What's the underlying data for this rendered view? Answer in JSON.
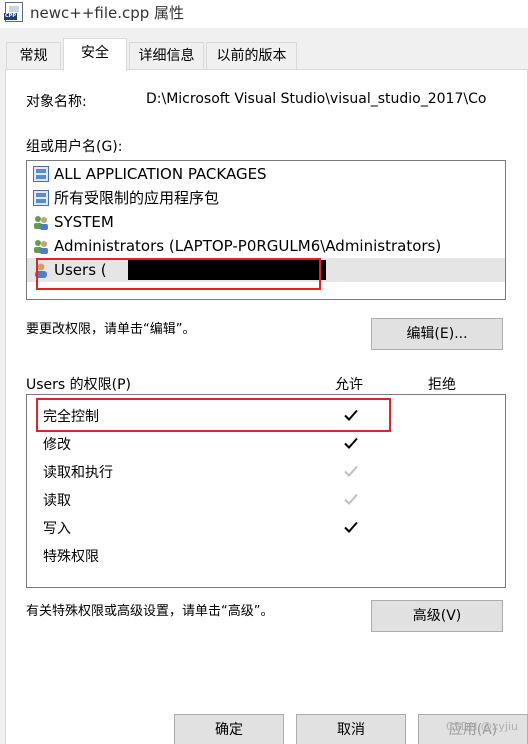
{
  "window": {
    "title": "newc++file.cpp 属性",
    "icon": "cpp-file-icon"
  },
  "tabs": [
    {
      "label": "常规",
      "active": false
    },
    {
      "label": "安全",
      "active": true
    },
    {
      "label": "详细信息",
      "active": false
    },
    {
      "label": "以前的版本",
      "active": false
    }
  ],
  "object": {
    "label": "对象名称:",
    "value": "D:\\Microsoft Visual Studio\\visual_studio_2017\\Co"
  },
  "groups": {
    "label": "组或用户名(G):",
    "items": [
      {
        "name": "ALL APPLICATION PACKAGES",
        "icon": "package-icon"
      },
      {
        "name": "所有受限制的应用程序包",
        "icon": "package-icon"
      },
      {
        "name": "SYSTEM",
        "icon": "users-icon"
      },
      {
        "name": "Administrators (LAPTOP-P0RGULM6\\Administrators)",
        "icon": "users-icon"
      },
      {
        "name": "Users (",
        "icon": "user-icon",
        "selected": true,
        "redacted": true
      }
    ]
  },
  "edit": {
    "hint": "要更改权限，请单击“编辑”。",
    "button": "编辑(E)..."
  },
  "permissions": {
    "header": "Users 的权限(P)",
    "allow_header": "允许",
    "deny_header": "拒绝",
    "rows": [
      {
        "name": "完全控制",
        "allow": "checked"
      },
      {
        "name": "修改",
        "allow": "checked"
      },
      {
        "name": "读取和执行",
        "allow": "inherited"
      },
      {
        "name": "读取",
        "allow": "inherited"
      },
      {
        "name": "写入",
        "allow": "checked"
      },
      {
        "name": "特殊权限",
        "allow": "none"
      }
    ]
  },
  "advanced": {
    "hint": "有关特殊权限或高级设置，请单击“高级”。",
    "button": "高级(V)"
  },
  "footer": {
    "ok": "确定",
    "cancel": "取消",
    "apply": "应用(A)"
  },
  "watermark": "CSDN @xyjiu",
  "colors": {
    "highlight": "#e0222a",
    "check_dark": "#000000",
    "check_light": "#c0c0c0"
  }
}
